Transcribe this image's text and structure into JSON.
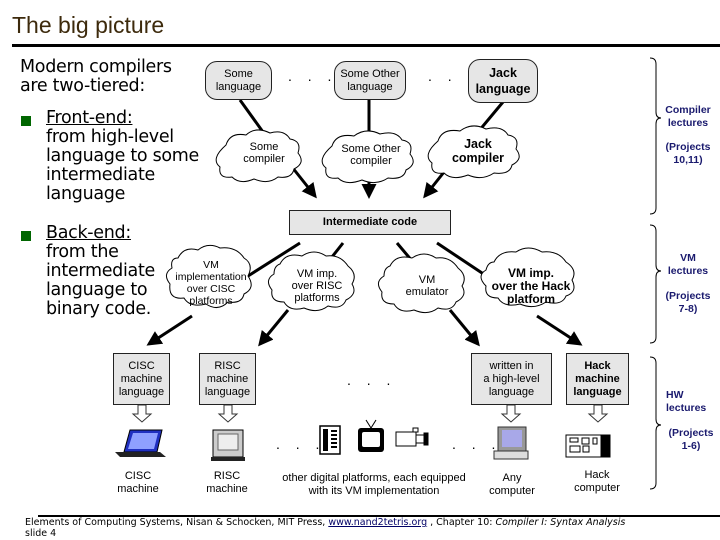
{
  "slide": {
    "title": "The big picture",
    "intro": [
      "Modern compilers",
      "are two-tiered:"
    ],
    "bullets": [
      {
        "heading": "Front-end:",
        "lines": [
          "from high-level",
          "language to some",
          "intermediate",
          "language"
        ]
      },
      {
        "heading": "Back-end:",
        "lines": [
          "from the",
          "intermediate",
          "language to",
          "binary code."
        ]
      }
    ],
    "accent_color": "#006600",
    "side_label_color": "#1a1a6e"
  },
  "diagram": {
    "languages": [
      {
        "lines": [
          "Some",
          "language"
        ],
        "bold": false
      },
      {
        "lines": [
          "Some Other",
          "language"
        ],
        "bold": false
      },
      {
        "lines": [
          "Jack",
          "language"
        ],
        "bold": true
      }
    ],
    "compilers": [
      {
        "lines": [
          "Some",
          "compiler"
        ],
        "bold": false
      },
      {
        "lines": [
          "Some Other",
          "compiler"
        ],
        "bold": false
      },
      {
        "lines": [
          "Jack",
          "compiler"
        ],
        "bold": true
      }
    ],
    "intermediate": "Intermediate code",
    "vm_impls": [
      {
        "lines": [
          "VM",
          "implementation",
          "over CISC",
          "platforms"
        ],
        "bold": false
      },
      {
        "lines": [
          "VM imp.",
          "over RISC",
          "platforms"
        ],
        "bold": false
      },
      {
        "lines": [
          "VM",
          "emulator"
        ],
        "bold": false
      },
      {
        "lines": [
          "VM imp.",
          "over the Hack",
          "platform"
        ],
        "bold": true
      }
    ],
    "machine_langs": [
      {
        "lines": [
          "CISC",
          "machine",
          "language"
        ],
        "bold": false
      },
      {
        "lines": [
          "RISC",
          "machine",
          "language"
        ],
        "bold": false
      },
      {
        "lines": [
          "written in",
          "a high-level",
          "language"
        ],
        "bold": false
      },
      {
        "lines": [
          "Hack",
          "machine",
          "language"
        ],
        "bold": true
      }
    ],
    "platforms": [
      {
        "label": [
          "CISC",
          "machine"
        ],
        "icon": "laptop-icon"
      },
      {
        "label": [
          "RISC",
          "machine"
        ],
        "icon": "workstation-icon"
      },
      {
        "label": [
          "other digital platforms, each equipped",
          "with its VM implementation"
        ],
        "icon": "devices-icon"
      },
      {
        "label": [
          "Any",
          "computer"
        ],
        "icon": "desktop-computer-icon"
      },
      {
        "label": [
          "Hack",
          "computer"
        ],
        "icon": "circuit-board-icon"
      }
    ],
    "ellipsis": ". . ."
  },
  "side_labels": [
    {
      "lines": [
        "Compiler",
        "lectures",
        "",
        "(Projects",
        "10,11)"
      ]
    },
    {
      "lines": [
        "VM",
        "lectures",
        "",
        "(Projects",
        "7-8)"
      ]
    },
    {
      "lines": [
        "HW",
        "lectures",
        "",
        "(Projects",
        "1-6)"
      ]
    }
  ],
  "footer": {
    "text_before": "Elements of Computing Systems, Nisan & Schocken, MIT Press,  ",
    "link": "www.nand2tetris.org",
    "text_after": " , Chapter 10: ",
    "chapter_title": "Compiler I: Syntax Analysis",
    "slide_label": "slide 4"
  }
}
